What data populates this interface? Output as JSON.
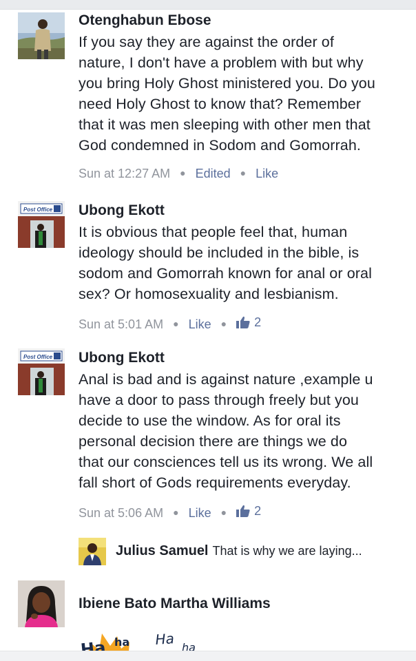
{
  "comments": [
    {
      "author": "Otenghabun Ebose",
      "lines": [
        "If you say they are against the order of",
        "nature, I don't have a problem with but why",
        "you bring Holy Ghost ministered you. Do you",
        "need Holy Ghost to know that? Remember",
        "that it was men sleeping with other men that",
        "God condemned in Sodom and Gomorrah."
      ],
      "time": "Sun at 12:27 AM",
      "edited": "Edited",
      "like": "Like"
    },
    {
      "author": "Ubong Ekott",
      "lines": [
        "It is obvious that people feel that, human",
        "ideology should be included in the bible, is",
        "sodom and Gomorrah known for anal or oral",
        "sex? Or homosexuality and lesbianism."
      ],
      "time": "Sun at 5:01 AM",
      "like": "Like",
      "like_count": "2"
    },
    {
      "author": "Ubong Ekott",
      "lines": [
        "Anal is bad and is against nature ,example u",
        "have a door to pass through freely but you",
        "decide to use the window. As for oral its",
        "personal decision there are things we do",
        "that our consciences tell us its wrong. We all",
        "fall short of Gods requirements everyday."
      ],
      "time": "Sun at 5:06 AM",
      "like": "Like",
      "like_count": "2"
    }
  ],
  "reply": {
    "author": "Julius Samuel",
    "preview": "That is why we are laying..."
  },
  "last_comment": {
    "author": "Ibiene Bato Martha Williams",
    "sticker_text": "Haha Haha"
  },
  "avatar_sign": {
    "text": "Post Office"
  },
  "colors": {
    "text": "#1d2129",
    "meta": "#90949c",
    "link": "#5b6f9c"
  }
}
